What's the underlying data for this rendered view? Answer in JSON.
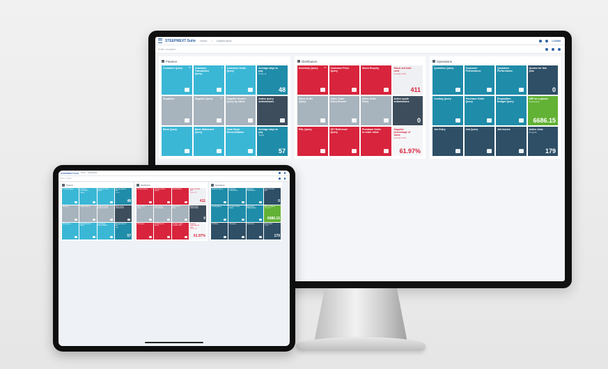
{
  "app": {
    "brand": "STEEPMEXT Suite",
    "crumbs": [
      "Home",
      "Dashboards"
    ],
    "user_label": "LOGIN",
    "search_placeholder": "Enter program"
  },
  "sections": [
    {
      "title": "Finance",
      "tiles": [
        {
          "title": "Customer Query",
          "count": "15",
          "color": "cyan",
          "icon": "person-icon"
        },
        {
          "title": "Customer Transaction Query",
          "count": "2",
          "color": "cyan",
          "icon": "bottle-icon"
        },
        {
          "title": "Customer Order Query",
          "count": "",
          "color": "cyan",
          "icon": "card-icon"
        },
        {
          "title": "Average days to pay",
          "sub": "Today 11",
          "value": "48",
          "color": "teal"
        },
        {
          "title": "Suppliers",
          "count": "",
          "color": "gray",
          "icon": "puzzle-icon"
        },
        {
          "title": "Supplier Query",
          "count": "14",
          "color": "gray",
          "icon": "plant-icon"
        },
        {
          "title": "Supplier Invoice Query by Value",
          "count": "",
          "color": "gray",
          "icon": "stack-icon"
        },
        {
          "title": "Active query submissions",
          "count": "",
          "color": "dark",
          "icon": "fork-icon"
        },
        {
          "title": "Bank Query",
          "count": "",
          "color": "cyan",
          "icon": "bulb-icon"
        },
        {
          "title": "Bank Statement Query",
          "count": "",
          "color": "cyan",
          "icon": "hourglass-icon"
        },
        {
          "title": "Cash Book Reconciliation",
          "count": "",
          "color": "cyan",
          "icon": "bank-icon"
        },
        {
          "title": "Average days to pay",
          "sub": "Target",
          "value": "57",
          "color": "teal"
        }
      ]
    },
    {
      "title": "Distribution",
      "tiles": [
        {
          "title": "Inventory Query",
          "count": "21",
          "color": "red",
          "icon": "grid-icon"
        },
        {
          "title": "Customer Price Query",
          "count": "",
          "color": "red",
          "icon": "bag-icon"
        },
        {
          "title": "Stock Enquiry",
          "count": "",
          "color": "red",
          "icon": "laptop-icon"
        },
        {
          "title": "Stock out hold next",
          "sub": "Constant 12%",
          "value": "411",
          "color": "lgray"
        },
        {
          "title": "Sales Order Query",
          "count": "",
          "color": "gray",
          "icon": "cart-icon"
        },
        {
          "title": "Sales Order Entry Review",
          "count": "",
          "color": "gray",
          "icon": "screen-icon"
        },
        {
          "title": "Sales Order Entry",
          "count": "",
          "color": "gray",
          "icon": "cart-icon"
        },
        {
          "title": "Active quote submissions",
          "value": "0",
          "color": "dark"
        },
        {
          "title": "P&L Query",
          "count": "",
          "color": "red",
          "icon": "box-icon"
        },
        {
          "title": "GIT Reference Query",
          "count": "",
          "color": "red",
          "icon": "doc-icon"
        },
        {
          "title": "Purchase Order to order value",
          "count": "",
          "color": "red",
          "icon": "eye-icon"
        },
        {
          "title": "Supplier percentage of value",
          "sub": "Constant 12%",
          "value": "61.97%",
          "color": "white"
        }
      ]
    },
    {
      "title": "Operations",
      "tiles": [
        {
          "title": "Quotation Query",
          "count": "",
          "color": "teal",
          "icon": "file-icon"
        },
        {
          "title": "Customer Performance",
          "count": "",
          "color": "teal",
          "icon": "pin-icon"
        },
        {
          "title": "Quotation Performance",
          "count": "",
          "color": "teal",
          "icon": "wifi-icon"
        },
        {
          "title": "Quotes for this year",
          "value": "0",
          "color": "navy"
        },
        {
          "title": "Costing Query",
          "count": "",
          "color": "teal",
          "icon": "tag-icon"
        },
        {
          "title": "Purchase Order Query",
          "count": "",
          "color": "teal",
          "icon": "cart-icon"
        },
        {
          "title": "Requisition Budget Query",
          "count": "",
          "color": "teal",
          "icon": "money-icon"
        },
        {
          "title": "WIP on a glance",
          "sub": "Outstanding",
          "value": "6686.15",
          "color": "green"
        },
        {
          "title": "Job Entry",
          "count": "",
          "color": "navy",
          "icon": "list-icon"
        },
        {
          "title": "Job Query",
          "count": "",
          "color": "navy",
          "icon": "image-icon"
        },
        {
          "title": "Job Issues",
          "count": "",
          "color": "navy",
          "icon": "bulb-icon"
        },
        {
          "title": "Active Jobs",
          "sub": "Progress",
          "value": "179",
          "color": "navy"
        }
      ]
    }
  ]
}
